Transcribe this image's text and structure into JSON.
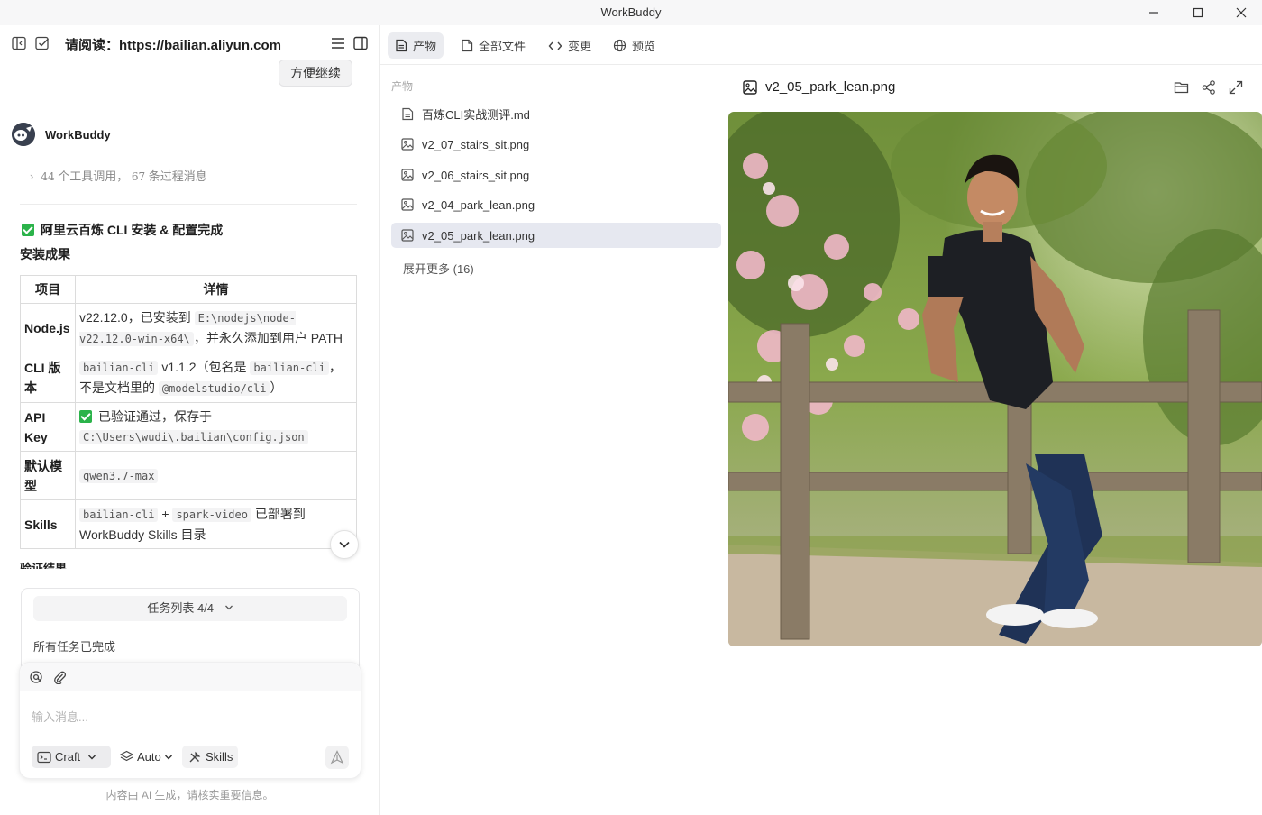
{
  "window": {
    "title": "WorkBuddy"
  },
  "left_header": {
    "title": "请阅读：https://bailian.aliyun.com"
  },
  "chat": {
    "continue_button": "方便继续",
    "agent_name": "WorkBuddy",
    "tool_calls_count": "44",
    "tool_calls_text": "个工具调用，",
    "process_count": "67",
    "process_text": "条过程消息",
    "done_title": "阿里云百炼 CLI 安装 & 配置完成",
    "result_title": "安装成果",
    "table": {
      "headers": [
        "项目",
        "详情"
      ],
      "rows": [
        {
          "key": "Node.js",
          "text_a": "v22.12.0，已安装到 ",
          "code_a": "E:\\nodejs\\node-v22.12.0-win-x64\\",
          "text_b": "，并永久添加到用户 PATH"
        },
        {
          "key": "CLI 版本",
          "code_a": "bailian-cli",
          "text_a": " v1.1.2（包名是 ",
          "code_b": "bailian-cli",
          "text_b": "，不是文档里的 ",
          "code_c": "@modelstudio/cli",
          "text_c": "）"
        },
        {
          "key": "API Key",
          "text_a": "已验证通过，保存于 ",
          "code_a": "C:\\Users\\wudi\\.bailian\\config.json"
        },
        {
          "key": "默认模型",
          "code_a": "qwen3.7-max"
        },
        {
          "key": "Skills",
          "code_a": "bailian-cli",
          "text_a": " + ",
          "code_b": "spark-video",
          "text_b": " 已部署到 WorkBuddy Skills 目录"
        }
      ]
    },
    "next_section_cut": "验证结果",
    "task_list_label": "任务列表 4/4",
    "task_status": "所有任务已完成",
    "input_placeholder": "输入消息...",
    "mode_craft": "Craft",
    "mode_auto": "Auto",
    "mode_skills": "Skills",
    "disclaimer": "内容由 AI 生成，请核实重要信息。"
  },
  "tabs": [
    {
      "label": "产物",
      "icon": "file-text-icon",
      "active": true
    },
    {
      "label": "全部文件",
      "icon": "file-icon",
      "active": false
    },
    {
      "label": "变更",
      "icon": "code-icon",
      "active": false
    },
    {
      "label": "预览",
      "icon": "globe-icon",
      "active": false
    }
  ],
  "files": {
    "section_label": "产物",
    "items": [
      {
        "name": "百炼CLI实战测评.md",
        "icon": "document-icon"
      },
      {
        "name": "v2_07_stairs_sit.png",
        "icon": "image-icon"
      },
      {
        "name": "v2_06_stairs_sit.png",
        "icon": "image-icon"
      },
      {
        "name": "v2_04_park_lean.png",
        "icon": "image-icon"
      },
      {
        "name": "v2_05_park_lean.png",
        "icon": "image-icon",
        "selected": true
      }
    ],
    "expand_more": "展开更多 (16)"
  },
  "preview": {
    "file_name": "v2_05_park_lean.png"
  },
  "colors": {
    "accent_check": "#2bb34a",
    "active_tab_bg": "#ebecf0",
    "selected_file_bg": "#e6e8f0"
  }
}
